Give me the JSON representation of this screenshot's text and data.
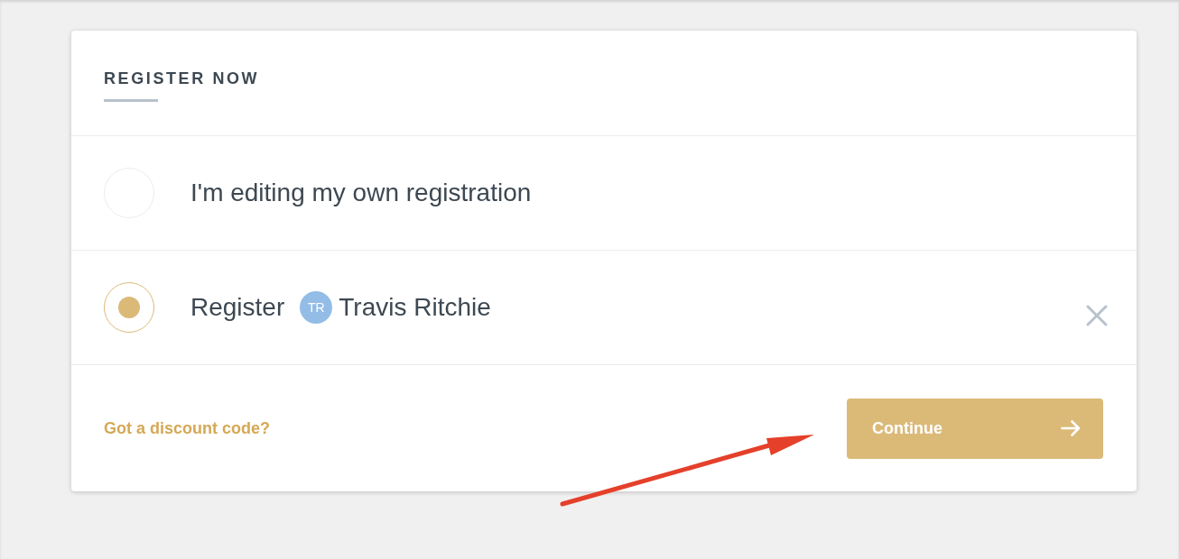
{
  "header": {
    "title": "REGISTER NOW"
  },
  "options": [
    {
      "kind": "text",
      "label": "I'm editing my own registration",
      "selected": false,
      "removable": false
    },
    {
      "kind": "person",
      "label": "Register",
      "avatar_initials": "TR",
      "person_name": "Travis Ritchie",
      "selected": true,
      "removable": true
    }
  ],
  "footer": {
    "discount_link": "Got a discount code?",
    "continue_button": "Continue"
  },
  "annotations": [
    {
      "kind": "arrow"
    }
  ]
}
